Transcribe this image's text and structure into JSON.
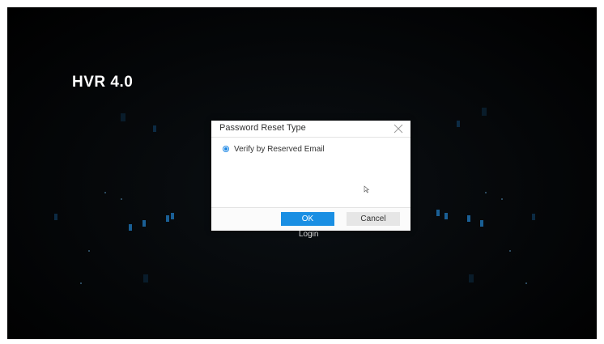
{
  "app": {
    "brand": "HVR 4.0",
    "login_label": "Login"
  },
  "dialog": {
    "title": "Password Reset Type",
    "close_icon": "close-x",
    "option": {
      "label": "Verify by Reserved Email",
      "selected": true
    },
    "ok_label": "OK",
    "cancel_label": "Cancel"
  },
  "colors": {
    "background": "#000000",
    "accent": "#1a8fe3",
    "decor_blue": "#1d6fae"
  }
}
